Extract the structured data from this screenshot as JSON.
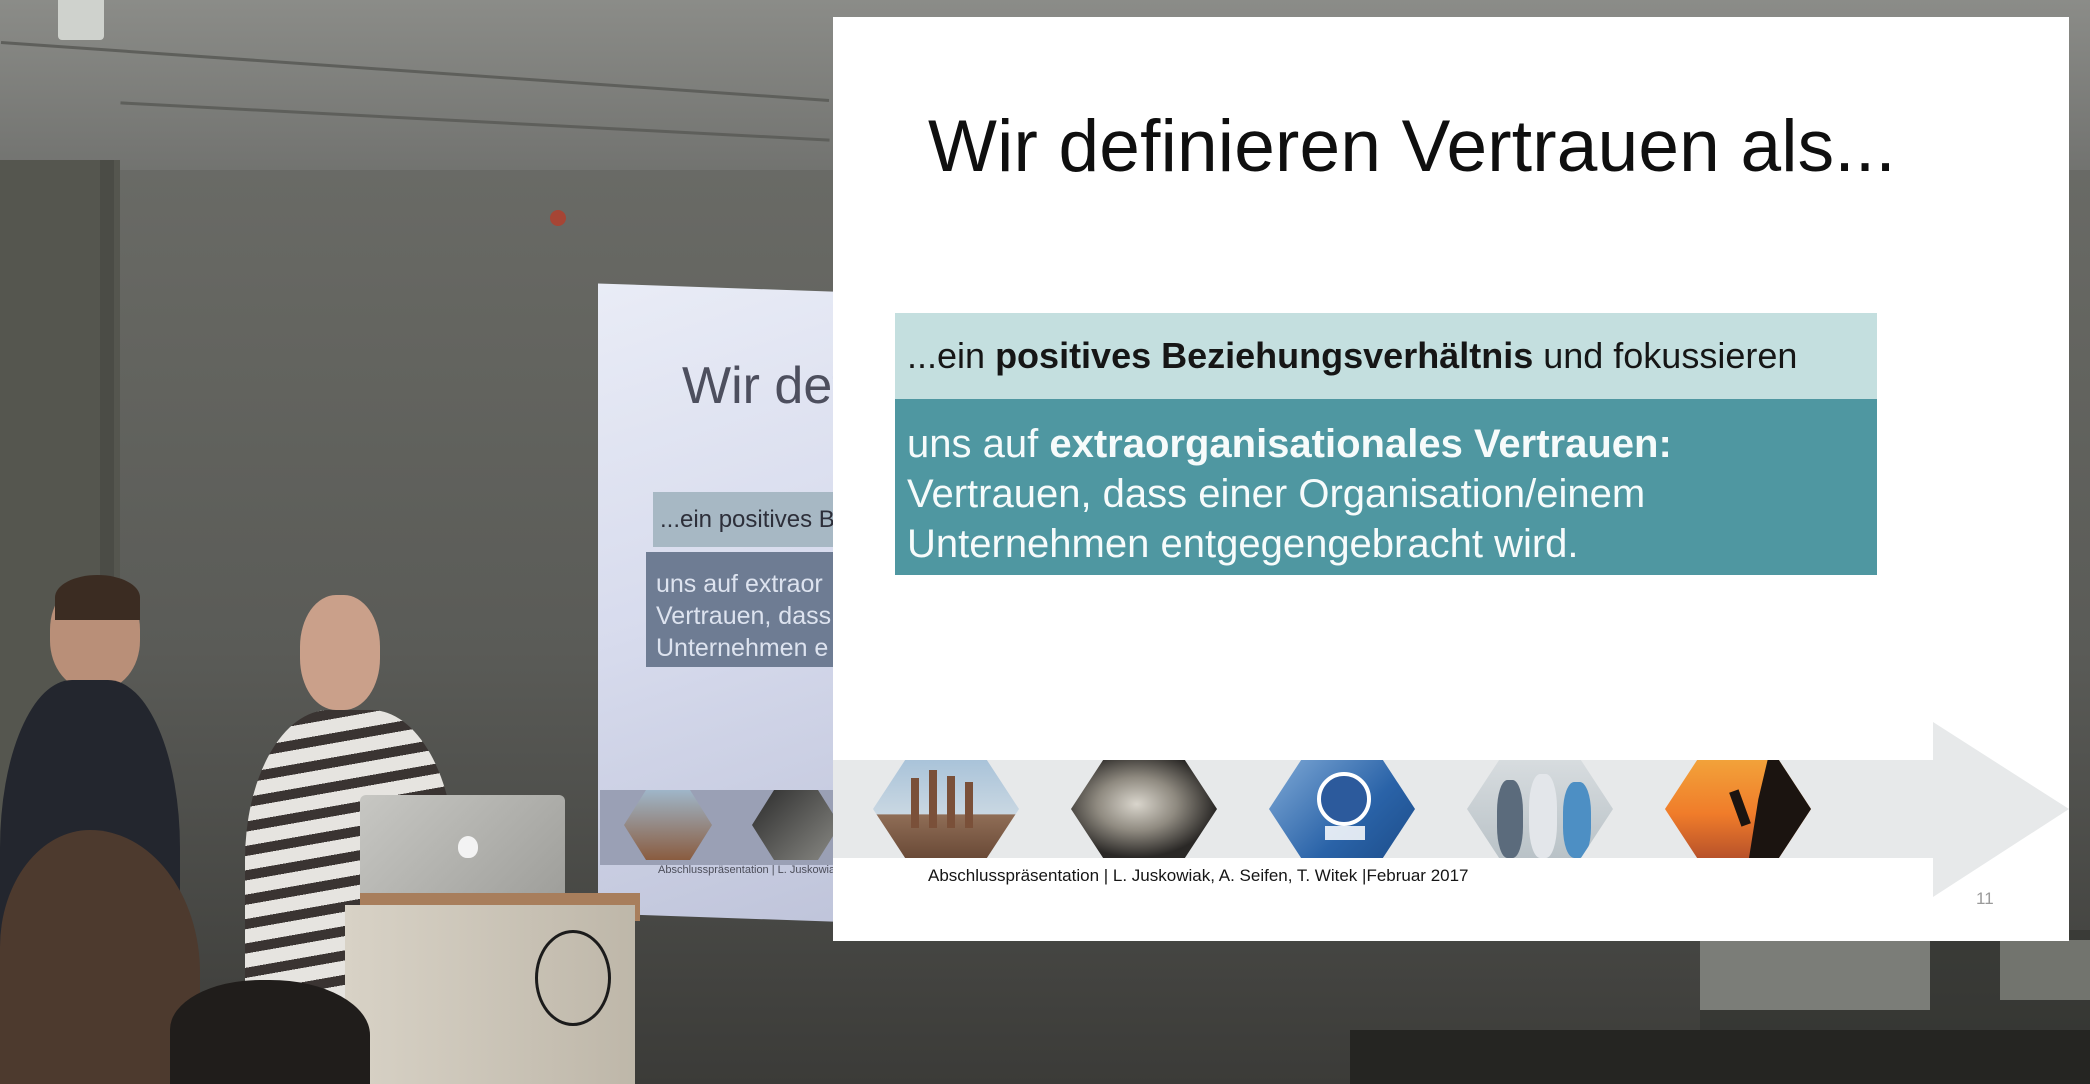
{
  "slide": {
    "title": "Wir definieren Vertrauen als...",
    "box_light": {
      "prefix": "...ein ",
      "bold": "positives Beziehungsverhältnis",
      "suffix": " und fokussieren"
    },
    "box_dark": {
      "prefix": "uns auf ",
      "bold": "extraorganisationales Vertrauen:",
      "line2": "Vertrauen, dass einer Organisation/einem",
      "line3": "Unternehmen entgegengebracht wird."
    },
    "images": [
      "factory-image",
      "fabric-image",
      "vw-service-sign-image",
      "people-talking-image",
      "climbers-sunset-image"
    ],
    "footer": "Abschlusspräsentation | L. Juskowiak, A. Seifen, T. Witek |Februar 2017",
    "page_number": "11",
    "colors": {
      "light_box": "#c4dfdf",
      "dark_box": "#4f97a1",
      "arrow": "#e7e9ea"
    }
  },
  "projection": {
    "title": "Wir def",
    "light_text": "...ein positives B",
    "dark_line1": "uns auf extraor",
    "dark_line2": "Vertrauen, dass",
    "dark_line3": "Unternehmen e",
    "footer": "Abschlusspräsentation | L. Juskowia"
  }
}
